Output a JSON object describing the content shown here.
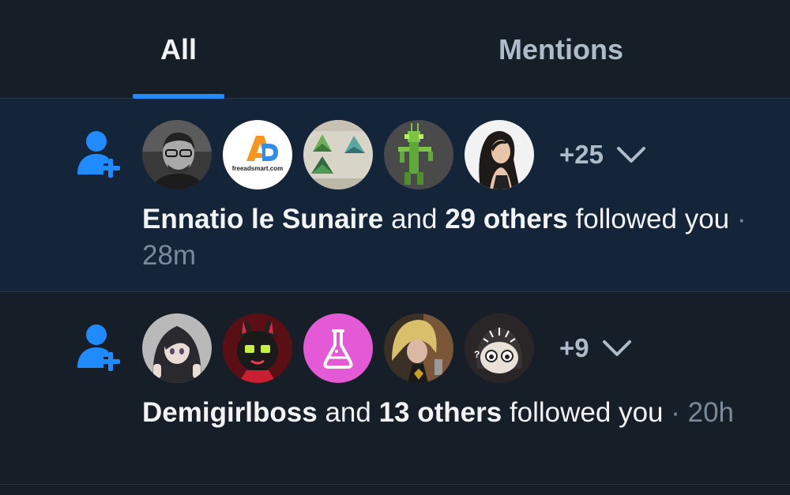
{
  "tabs": [
    {
      "label": "All",
      "active": true
    },
    {
      "label": "Mentions",
      "active": false
    }
  ],
  "colors": {
    "accent": "#208bfe",
    "background": "#161e27",
    "unread_background": "#142539",
    "text": "#f1f3f5",
    "muted": "#7b8a9a"
  },
  "notifications": [
    {
      "icon": "person-add-icon",
      "avatars": [
        "avatar-bearded-man",
        "avatar-freeadsmart",
        "avatar-green-triangles",
        "avatar-pixel-mantis",
        "avatar-dark-haired-woman"
      ],
      "logo_text": "freeadsmart.com",
      "more_count": "+25",
      "actor": "Ennatio le Sunaire",
      "connector": " and ",
      "others": "29 others",
      "action": " followed you",
      "separator": " · ",
      "time": "28m",
      "unread": true
    },
    {
      "icon": "person-add-icon",
      "avatars": [
        "avatar-anime-girl",
        "avatar-black-cat",
        "avatar-flask",
        "avatar-punk-person",
        "avatar-cartoon-face"
      ],
      "more_count": "+9",
      "actor": "Demigirlboss",
      "connector": " and ",
      "others": "13 others",
      "action": " followed you",
      "separator": " · ",
      "time": "20h",
      "unread": false
    }
  ]
}
